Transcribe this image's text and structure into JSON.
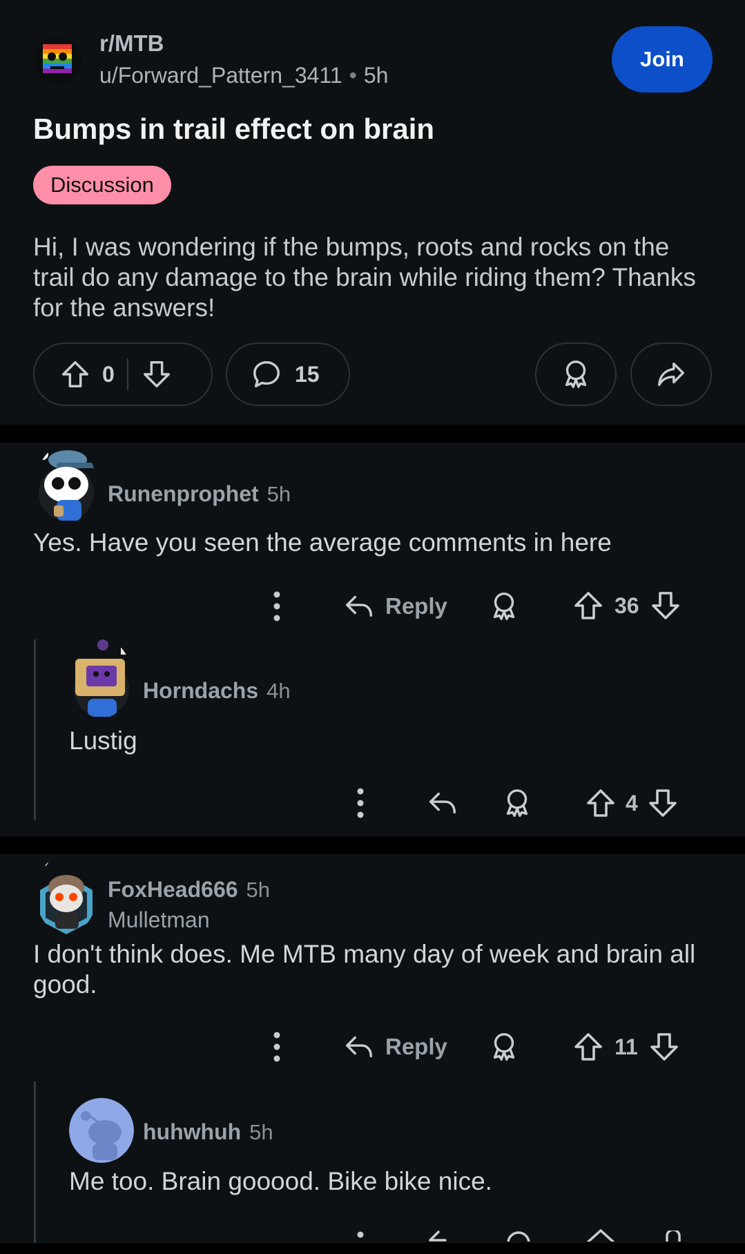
{
  "post": {
    "subreddit": "r/MTB",
    "author": "u/Forward_Pattern_3411",
    "separator": "•",
    "age": "5h",
    "join_label": "Join",
    "title": "Bumps in trail effect on brain",
    "flair": "Discussion",
    "body": "Hi, I was wondering if the bumps, roots and rocks on the trail do any damage to the brain while riding them? Thanks for the answers!",
    "score": "0",
    "comment_count": "15"
  },
  "comments": [
    {
      "username": "Runenprophet",
      "age": "5h",
      "text": "Yes. Have you seen the average comments in here",
      "reply_label": "Reply",
      "score": "36"
    },
    {
      "username": "Horndachs",
      "age": "4h",
      "text": "Lustig",
      "score": "4"
    },
    {
      "username": "FoxHead666",
      "age": "5h",
      "flair": "Mulletman",
      "text": "I don't think does. Me MTB many day of week and brain all good.",
      "reply_label": "Reply",
      "score": "11"
    },
    {
      "username": "huhwhuh",
      "age": "5h",
      "text": "Me too. Brain gooood. Bike bike nice."
    }
  ],
  "colors": {
    "background": "#0e1113",
    "join_button": "#0d4fc9",
    "flair_bg": "#ff8fa8"
  },
  "icons": [
    "upvote-icon",
    "downvote-icon",
    "comment-icon",
    "award-icon",
    "share-icon",
    "reply-icon",
    "more-icon"
  ]
}
